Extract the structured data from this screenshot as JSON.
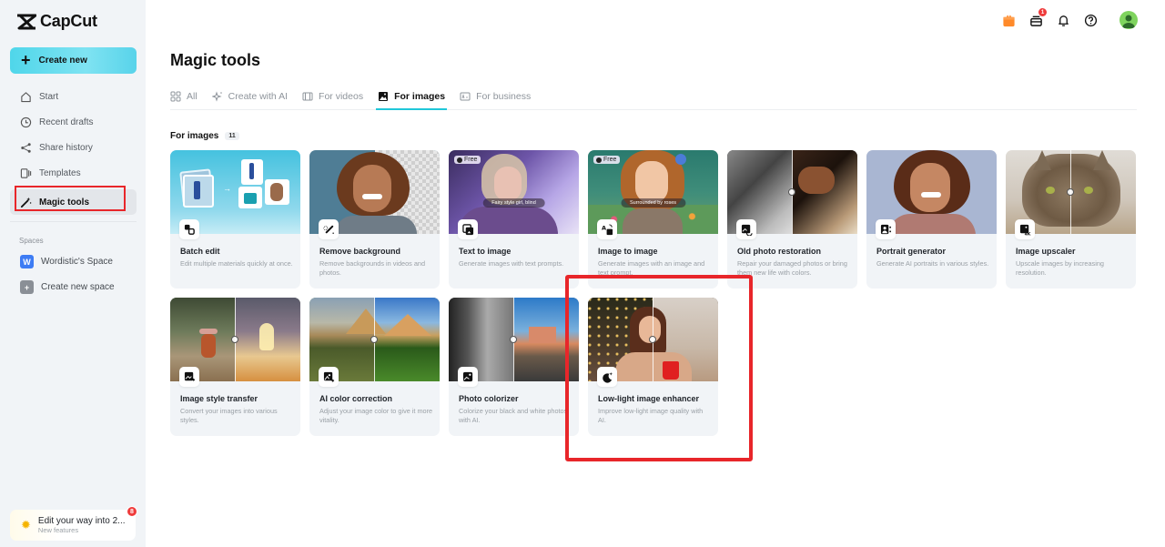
{
  "app": {
    "name": "CapCut"
  },
  "sidebar": {
    "create_new": "Create new",
    "items": [
      {
        "label": "Start",
        "icon": "home-icon",
        "active": false
      },
      {
        "label": "Recent drafts",
        "icon": "clock-icon",
        "active": false
      },
      {
        "label": "Share history",
        "icon": "share-icon",
        "active": false
      },
      {
        "label": "Templates",
        "icon": "templates-icon",
        "active": false
      },
      {
        "label": "Magic tools",
        "icon": "magic-wand-icon",
        "active": true
      }
    ],
    "spaces_label": "Spaces",
    "spaces": [
      {
        "label": "Wordistic's Space",
        "badge": "W",
        "color": "#3d7cf4"
      },
      {
        "label": "Create new space",
        "badge": "+",
        "color": "#8a8f96"
      }
    ],
    "promo": {
      "title": "Edit your way into 2...",
      "subtitle": "New features",
      "badge": "8"
    }
  },
  "topbar": {
    "icons": [
      "gift-icon",
      "inbox-icon",
      "bell-icon",
      "help-icon",
      "avatar"
    ],
    "inbox_badge": "1"
  },
  "main": {
    "title": "Magic tools",
    "tabs": [
      {
        "label": "All",
        "icon": "grid-icon",
        "active": false
      },
      {
        "label": "Create with AI",
        "icon": "sparkle-icon",
        "active": false
      },
      {
        "label": "For videos",
        "icon": "film-icon",
        "active": false
      },
      {
        "label": "For images",
        "icon": "image-icon",
        "active": true
      },
      {
        "label": "For business",
        "icon": "business-icon",
        "active": false
      }
    ],
    "section": {
      "title": "For images",
      "count": "11"
    },
    "tools": [
      {
        "title": "Batch edit",
        "desc": "Edit multiple materials quickly at once.",
        "icon": "batch-icon"
      },
      {
        "title": "Remove background",
        "desc": "Remove backgrounds in videos and photos.",
        "icon": "remove-bg-icon"
      },
      {
        "title": "Text to image",
        "desc": "Generate images with text prompts.",
        "icon": "text-to-image-icon",
        "free": "Free",
        "caption": "Fairy style girl, blind"
      },
      {
        "title": "Image to image",
        "desc": "Generate images with an image and text prompt.",
        "icon": "image-to-image-icon",
        "free": "Free",
        "caption": "Surrounded by roses"
      },
      {
        "title": "Old photo restoration",
        "desc": "Repair your damaged photos or bring them new life with colors.",
        "icon": "restore-icon"
      },
      {
        "title": "Portrait generator",
        "desc": "Generate AI portraits in various styles.",
        "icon": "portrait-icon"
      },
      {
        "title": "Image upscaler",
        "desc": "Upscale images by increasing resolution.",
        "icon": "upscale-4k-icon"
      },
      {
        "title": "Image style transfer",
        "desc": "Convert your images into various styles.",
        "icon": "style-transfer-icon"
      },
      {
        "title": "AI color correction",
        "desc": "Adjust your image color to give it more vitality.",
        "icon": "color-correction-icon"
      },
      {
        "title": "Photo colorizer",
        "desc": "Colorize your black and white photos with AI.",
        "icon": "colorizer-icon"
      },
      {
        "title": "Low-light image enhancer",
        "desc": "Improve low-light image quality with AI.",
        "icon": "moon-sparkle-icon",
        "highlighted": true
      }
    ]
  },
  "colors": {
    "accent": "#20c7d9",
    "highlight": "#e8262a",
    "sidebar_bg": "#f1f4f7",
    "card_bg": "#f1f4f7"
  }
}
